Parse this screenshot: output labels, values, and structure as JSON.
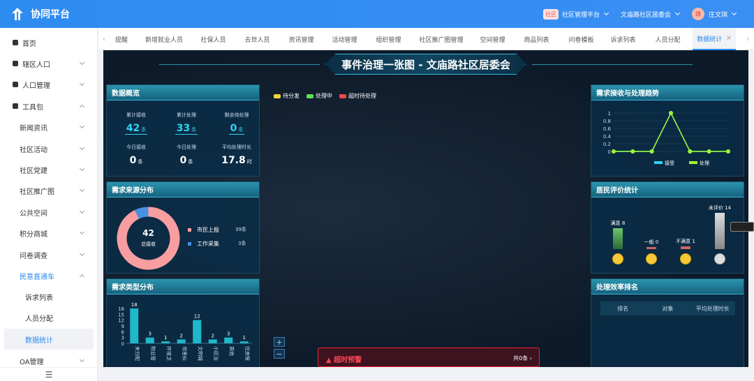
{
  "app": {
    "title": "协同平台"
  },
  "topbar": {
    "platform_badge": "社区",
    "platform_label": "社区管理平台",
    "org_label": "文庙路社区居委会",
    "user_avatar": "琪",
    "user_name": "庄文琪"
  },
  "sidebar": {
    "items": [
      {
        "label": "首页",
        "icon": "home-icon",
        "expandable": false
      },
      {
        "label": "辖区人口",
        "icon": "book-icon",
        "expandable": true
      },
      {
        "label": "人口管理",
        "icon": "user-icon",
        "expandable": true
      },
      {
        "label": "工具包",
        "icon": "toolkit-icon",
        "expandable": true,
        "expanded": true
      },
      {
        "label": "新闻资讯",
        "expandable": true
      },
      {
        "label": "社区活动",
        "expandable": true
      },
      {
        "label": "社区党建",
        "expandable": true
      },
      {
        "label": "社区推广图",
        "expandable": true
      },
      {
        "label": "公共空间",
        "expandable": true
      },
      {
        "label": "积分商城",
        "expandable": true
      },
      {
        "label": "问卷调查",
        "expandable": true
      },
      {
        "label": "民意直通车",
        "expandable": true,
        "expanded": true,
        "active": true
      },
      {
        "label": "诉求列表"
      },
      {
        "label": "人员分配"
      },
      {
        "label": "数据统计",
        "selected": true
      },
      {
        "label": "OA管理",
        "expandable": true
      }
    ],
    "footer_icon": "menu-fold-icon"
  },
  "tabs": [
    "提醒",
    "新增就业人员",
    "社保人员",
    "去世人员",
    "资讯管理",
    "活动管理",
    "组织管理",
    "社区推广图管理",
    "空间管理",
    "商品列表",
    "问卷模板",
    "诉求列表",
    "人员分配",
    "数据统计"
  ],
  "active_tab": "数据统计",
  "dashboard": {
    "title": "事件治理一张图 - 文庙路社区居委会",
    "overview": {
      "title": "数据概览",
      "stats": [
        {
          "label": "累计接收",
          "value": "42",
          "unit": "条"
        },
        {
          "label": "累计处理",
          "value": "33",
          "unit": "条"
        },
        {
          "label": "剩余待处理",
          "value": "0",
          "unit": "条"
        },
        {
          "label": "今日接收",
          "value": "0",
          "unit": "条"
        },
        {
          "label": "今日处理",
          "value": "0",
          "unit": "条"
        },
        {
          "label": "平均处理时长",
          "value": "17.8",
          "unit": "时"
        }
      ]
    },
    "source": {
      "title": "需求来源分布",
      "total": "42",
      "total_label": "总接收",
      "items": [
        {
          "label": "市民上报",
          "count": "39条",
          "value": 39,
          "color": "#f99ea0"
        },
        {
          "label": "工作采集",
          "count": "3条",
          "value": 3,
          "color": "#4a90e2"
        }
      ]
    },
    "type_dist": {
      "title": "需求类型分布",
      "chart_data": {
        "type": "bar",
        "categories": [
          "未分配",
          "物业管",
          "环境卫",
          "邻里纠",
          "文明城",
          "小区治",
          "其他",
          "住房保"
        ],
        "values": [
          18,
          3,
          1,
          2,
          12,
          2,
          3,
          1
        ],
        "yticks": [
          "0",
          "3",
          "6",
          "9",
          "12",
          "15",
          "18"
        ],
        "ylim": [
          0,
          18
        ]
      }
    },
    "map_legend": [
      {
        "label": "待分发",
        "color": "#f5d33a"
      },
      {
        "label": "处理中",
        "color": "#5ee05a"
      },
      {
        "label": "超时待处理",
        "color": "#f04848"
      }
    ],
    "zoom": {
      "in": "+",
      "out": "−"
    },
    "alert": {
      "title": "超时预警",
      "count": "共0条"
    },
    "trend": {
      "title": "需求接收与处理趋势",
      "chart_data": {
        "type": "line",
        "x": [
          "",
          "",
          "",
          "",
          "",
          "",
          ""
        ],
        "series": [
          {
            "name": "接受",
            "values": [
              0,
              0,
              0,
              1,
              0,
              0,
              0
            ],
            "color": "#2fd4f5"
          },
          {
            "name": "处理",
            "values": [
              0,
              0,
              0,
              1,
              0,
              0,
              0
            ],
            "color": "#9ef534"
          }
        ],
        "yticks": [
          "0",
          "0.2",
          "0.4",
          "0.6",
          "0.8",
          "1"
        ],
        "ylim": [
          0,
          1
        ]
      }
    },
    "rating": {
      "title": "居民评价统计",
      "items": [
        {
          "label": "满意 8",
          "value": 8,
          "face": "happy-face-icon"
        },
        {
          "label": "一般 0",
          "value": 0,
          "face": "neutral-face-icon"
        },
        {
          "label": "不满意 1",
          "value": 1,
          "face": "sad-face-icon"
        },
        {
          "label": "未评价 14",
          "value": 14,
          "face": "unrated-face-icon"
        }
      ]
    },
    "ranking": {
      "title": "处理效率排名",
      "headers": [
        "排名",
        "对象",
        "平均处理时长"
      ]
    }
  }
}
